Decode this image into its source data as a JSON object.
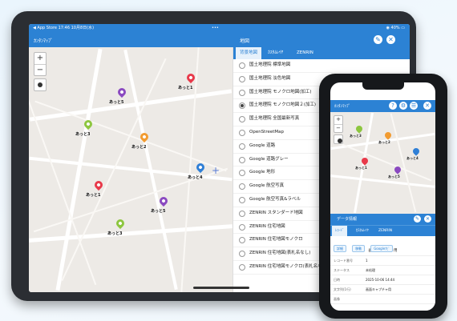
{
  "tablet": {
    "status": {
      "left": "◀ App Store  17:46  10月8日(水)",
      "dots": "•••",
      "right": "◉ 40% ▭"
    },
    "nav": {
      "title": "ｶﾝﾀﾝﾏｯﾌﾟ",
      "panel_title": "地図"
    },
    "map": {
      "zoom_in": "+",
      "zoom_out": "−",
      "crosshair": "+"
    },
    "pins": [
      {
        "label": "あっと1",
        "color": "#e8394a"
      },
      {
        "label": "あっと5",
        "color": "#8a49c0"
      },
      {
        "label": "あっと3",
        "color": "#8dc63f"
      },
      {
        "label": "あっと2",
        "color": "#f29b30"
      },
      {
        "label": "あっと4",
        "color": "#2f7fd6"
      },
      {
        "label": "あっと1",
        "color": "#e8394a"
      },
      {
        "label": "あっと5",
        "color": "#8a49c0"
      },
      {
        "label": "あっと3",
        "color": "#8dc63f"
      }
    ],
    "tabs": [
      "背景地図",
      "ｶｽﾀﾑﾚｲﾔ",
      "ZENRIN"
    ],
    "options": [
      {
        "label": "国土地理院 標準地図",
        "selected": false
      },
      {
        "label": "国土地理院 淡色地図",
        "selected": false
      },
      {
        "label": "国土地理院 モノクロ地図(加工)",
        "selected": false
      },
      {
        "label": "国土地理院 モノクロ地図２(加工)",
        "selected": true
      },
      {
        "label": "国土地理院 全国最新写真",
        "selected": false
      },
      {
        "label": "OpenStreetMap",
        "selected": false
      },
      {
        "label": "Google 道路",
        "selected": false
      },
      {
        "label": "Google 道路グレー",
        "selected": false
      },
      {
        "label": "Google 地形",
        "selected": false
      },
      {
        "label": "Google 航空写真",
        "selected": false
      },
      {
        "label": "Google 航空写真&ラベル",
        "selected": false
      },
      {
        "label": "ZENRIN スタンダード地図",
        "selected": false
      },
      {
        "label": "ZENRIN 住宅地図",
        "selected": false
      },
      {
        "label": "ZENRIN 住宅地図モノクロ",
        "selected": false
      },
      {
        "label": "ZENRIN 住宅地図(表札名なし)",
        "selected": false
      },
      {
        "label": "ZENRIN 住宅地図モノクロ(表札名なし)",
        "selected": false
      }
    ]
  },
  "phone": {
    "nav": {
      "title": "ｶﾝﾀﾝﾏｯﾌﾟ"
    },
    "pins": [
      {
        "label": "あっと3",
        "color": "#8dc63f"
      },
      {
        "label": "あっと2",
        "color": "#f29b30"
      },
      {
        "label": "あっと4",
        "color": "#2f7fd6"
      },
      {
        "label": "あっと1",
        "color": "#e8394a"
      },
      {
        "label": "あっと5",
        "color": "#8a49c0"
      }
    ],
    "sheet": {
      "title": "データ情報",
      "tabs": [
        "ﾚｺｰﾄﾞ",
        "ｶｽﾀﾑﾚｲﾔ",
        "ZENRIN"
      ],
      "chips": [
        "詳細",
        "移動",
        "Googleﾅﾋﾞ"
      ],
      "image_caption": "画面キャプチャ用",
      "rows": [
        {
          "k": "レコード番号",
          "v": "1"
        },
        {
          "k": "ステータス",
          "v": "未処理"
        },
        {
          "k": "日時",
          "v": "2025-10-06 14:44"
        },
        {
          "k": "文字列(1行)",
          "v": "画面キャプチャ用"
        },
        {
          "k": "画像",
          "v": ""
        }
      ]
    }
  }
}
